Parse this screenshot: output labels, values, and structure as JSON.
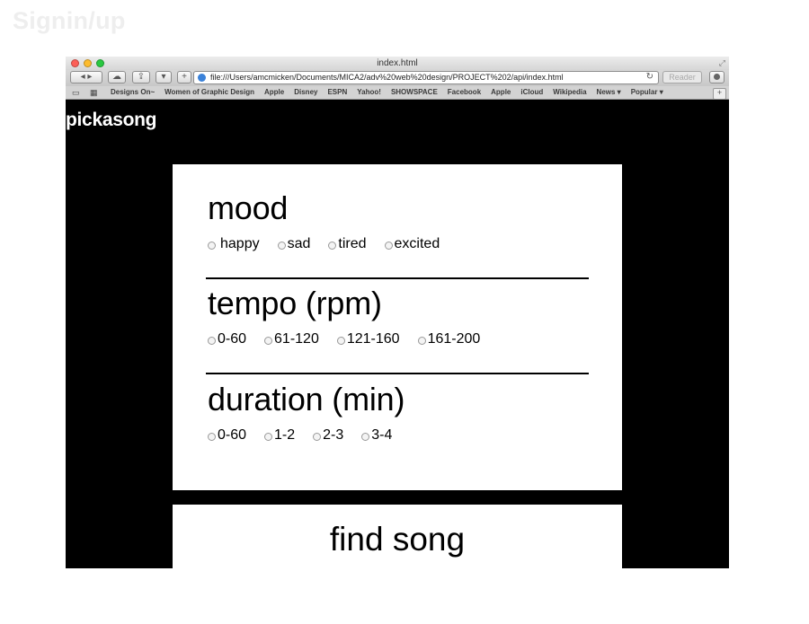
{
  "page_label": "Signin/up",
  "browser": {
    "window_title": "index.html",
    "url": "file:///Users/amcmicken/Documents/MICA2/adv%20web%20design/PROJECT%202/api/index.html",
    "reader_label": "Reader",
    "bookmarks": [
      "Designs On~",
      "Women of Graphic Design",
      "Apple",
      "Disney",
      "ESPN",
      "Yahoo!",
      "SHOWSPACE",
      "Facebook",
      "Apple",
      "iCloud",
      "Wikipedia",
      "News ▾",
      "Popular ▾"
    ]
  },
  "app": {
    "brand": "pickasong",
    "mood": {
      "title": "mood",
      "options": [
        "happy",
        "sad",
        "tired",
        "excited"
      ]
    },
    "tempo": {
      "title": "tempo (rpm)",
      "options": [
        "0-60",
        "61-120",
        "121-160",
        "161-200"
      ]
    },
    "duration": {
      "title": "duration (min)",
      "options": [
        "0-60",
        "1-2",
        "2-3",
        "3-4"
      ]
    },
    "find_button": "find song"
  }
}
